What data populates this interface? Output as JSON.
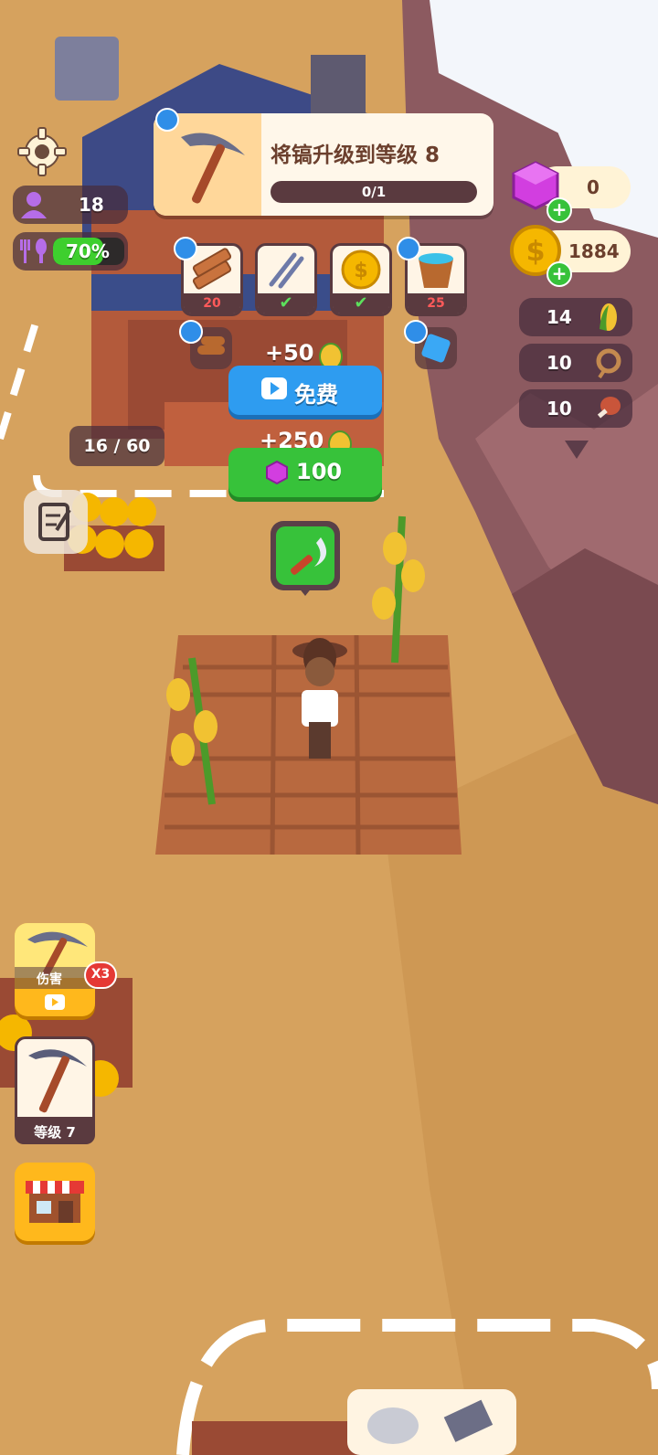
{
  "hud": {
    "population": "18",
    "food_percent": "70%",
    "food_fill": 0.7,
    "gems": "0",
    "coins": "1884"
  },
  "upgrade_panel": {
    "title": "将镐升级到等级 8",
    "progress_text": "0/1",
    "progress_fill": 0.0,
    "requirements": [
      {
        "icon": "wood-planks-icon",
        "count": "20",
        "done": false
      },
      {
        "icon": "nails-icon",
        "count": "",
        "done": true
      },
      {
        "icon": "gold-coin-icon",
        "count": "",
        "done": true
      },
      {
        "icon": "water-bucket-icon",
        "count": "25",
        "done": false
      }
    ]
  },
  "inventory": [
    {
      "icon": "corn-icon",
      "count": "14"
    },
    {
      "icon": "rope-icon",
      "count": "10"
    },
    {
      "icon": "meat-icon",
      "count": "10"
    }
  ],
  "offers": {
    "free": {
      "reward": "+50",
      "label": "免费"
    },
    "paid": {
      "reward": "+250",
      "price": "100"
    }
  },
  "storage": {
    "text": "16 / 60"
  },
  "damage_boost": {
    "label": "伤害",
    "multiplier": "X3"
  },
  "pickaxe_tool": {
    "label": "等级 7"
  },
  "colors": {
    "blue_button": "#2e9cf0",
    "green_button": "#37c23a",
    "food_green": "#3ecf2e",
    "gem_purple": "#d23ee0",
    "coin_gold": "#f5b700",
    "soil": "#b8693f"
  }
}
